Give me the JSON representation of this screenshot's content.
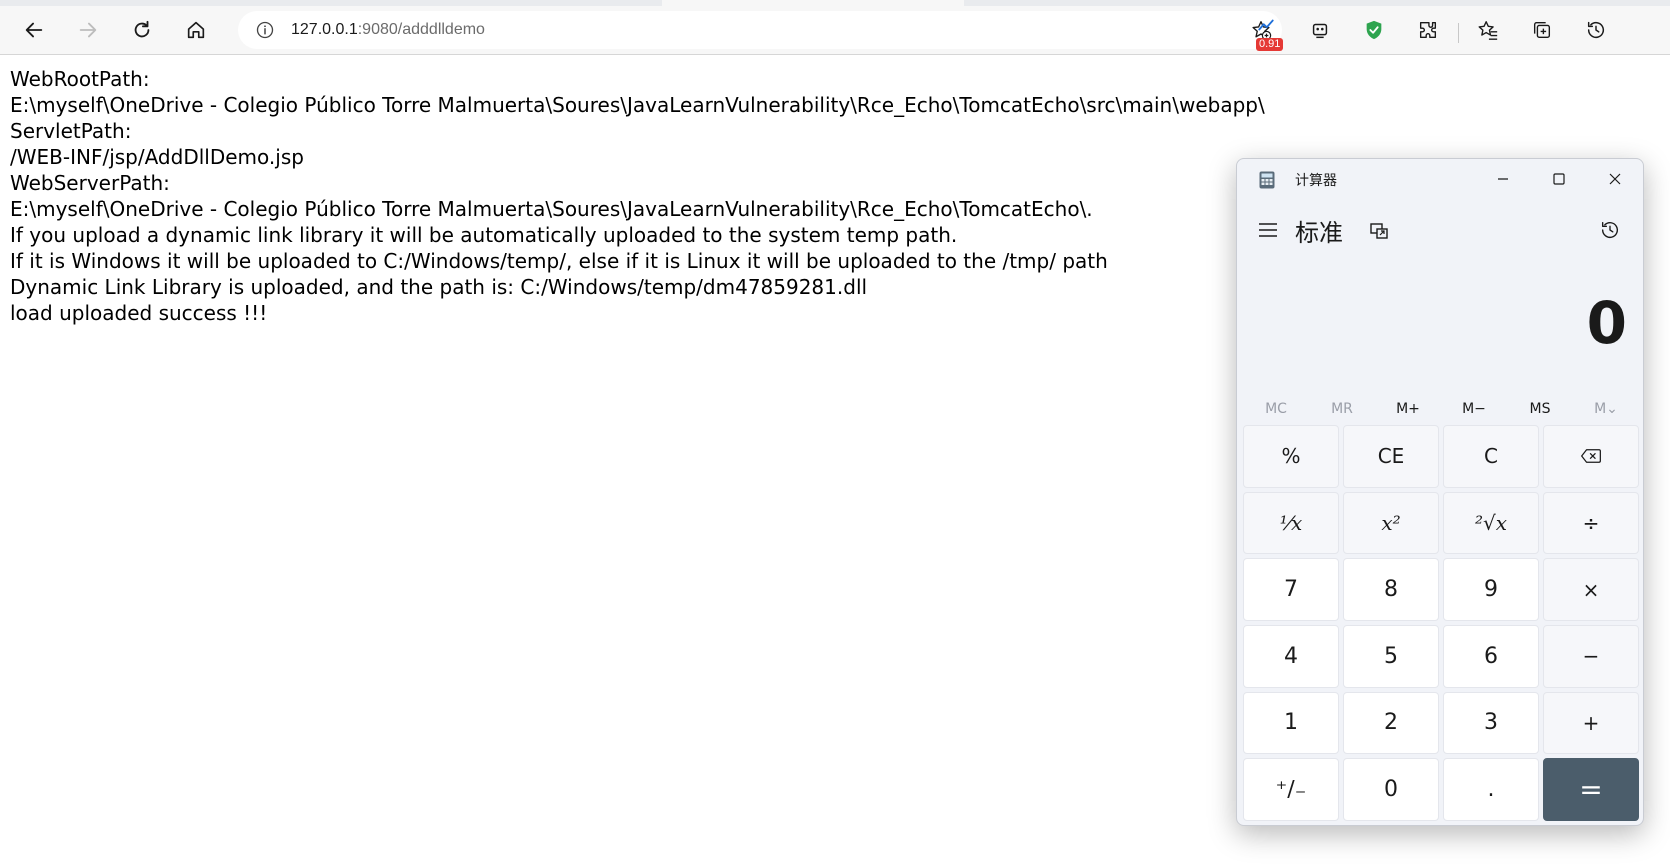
{
  "browser": {
    "url_host": "127.0.0.1",
    "url_rest": ":9080/adddlldemo",
    "extension_badge": "0.91"
  },
  "page": {
    "lines": [
      "WebRootPath:",
      "E:\\myself\\OneDrive - Colegio Público Torre Malmuerta\\Soures\\JavaLearnVulnerability\\Rce_Echo\\TomcatEcho\\src\\main\\webapp\\",
      "ServletPath:",
      "/WEB-INF/jsp/AddDllDemo.jsp",
      "WebServerPath:",
      "E:\\myself\\OneDrive - Colegio Público Torre Malmuerta\\Soures\\JavaLearnVulnerability\\Rce_Echo\\TomcatEcho\\.",
      "If you upload a dynamic link library it will be automatically uploaded to the system temp path.",
      "If it is Windows it will be uploaded to C:/Windows/temp/, else if it is Linux it will be uploaded to the /tmp/ path",
      "Dynamic Link Library is uploaded, and the path is: C:/Windows/temp/dm47859281.dll",
      "load uploaded success !!!"
    ]
  },
  "calculator": {
    "title": "计算器",
    "mode": "标准",
    "display": "0",
    "memory": [
      "MC",
      "MR",
      "M+",
      "M−",
      "MS",
      "M⌄"
    ],
    "keys": {
      "percent": "%",
      "ce": "CE",
      "c": "C",
      "reciprocal": "⅟x",
      "square": "x²",
      "sqrt": "²√x",
      "divide": "÷",
      "seven": "7",
      "eight": "8",
      "nine": "9",
      "multiply": "×",
      "four": "4",
      "five": "5",
      "six": "6",
      "minus": "−",
      "one": "1",
      "two": "2",
      "three": "3",
      "plus": "+",
      "negate": "⁺∕₋",
      "zero": "0",
      "decimal": ".",
      "equals": "="
    }
  }
}
